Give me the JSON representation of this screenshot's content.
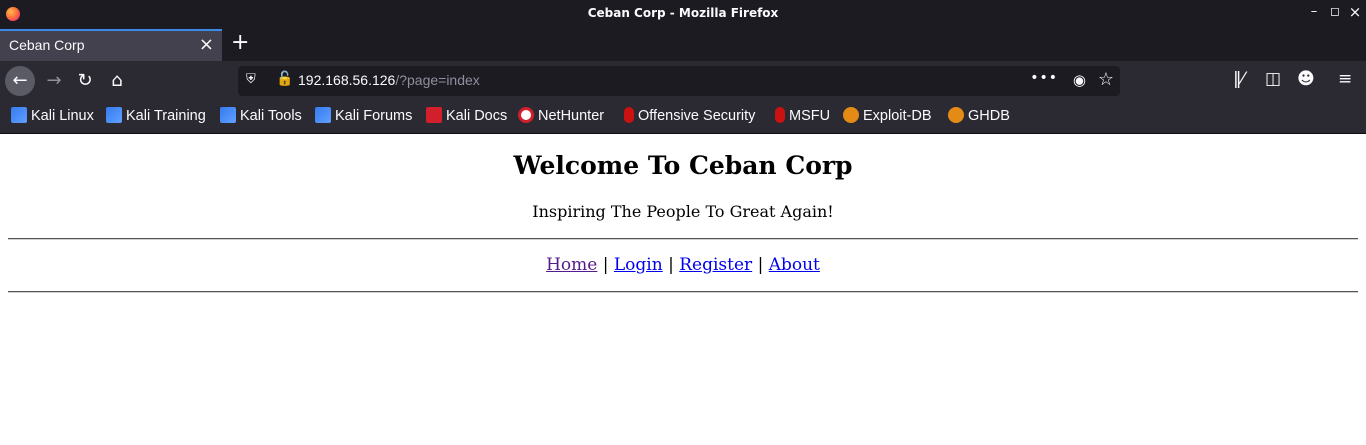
{
  "window": {
    "title": "Ceban Corp - Mozilla Firefox"
  },
  "tab": {
    "title": "Ceban Corp"
  },
  "urlbar": {
    "host": "192.168.56.126",
    "path": "/?page=index"
  },
  "bookmarks": [
    "Kali Linux",
    "Kali Training",
    "Kali Tools",
    "Kali Forums",
    "Kali Docs",
    "NetHunter",
    "Offensive Security",
    "MSFU",
    "Exploit-DB",
    "GHDB"
  ],
  "page": {
    "heading": "Welcome To Ceban Corp",
    "tagline": "Inspiring The People To Great Again!",
    "nav": [
      "Home",
      "Login",
      "Register",
      "About"
    ],
    "separator": "|"
  },
  "icons": {
    "back": "back-arrow-icon",
    "forward": "forward-arrow-icon",
    "reload": "reload-icon",
    "home": "home-icon",
    "shield": "shield-icon",
    "lock": "insecure-lock-icon",
    "more": "more-icon",
    "pocket": "pocket-icon",
    "star": "star-icon",
    "library": "library-icon",
    "sidebar": "sidebar-icon",
    "account": "account-icon",
    "menu": "menu-icon"
  },
  "colors": {
    "chrome_dark": "#1c1b22",
    "toolbar": "#2b2a33",
    "tab_active": "#42414d",
    "accent": "#3a8be8",
    "link": "#0000ee",
    "visited": "#551a8b"
  }
}
